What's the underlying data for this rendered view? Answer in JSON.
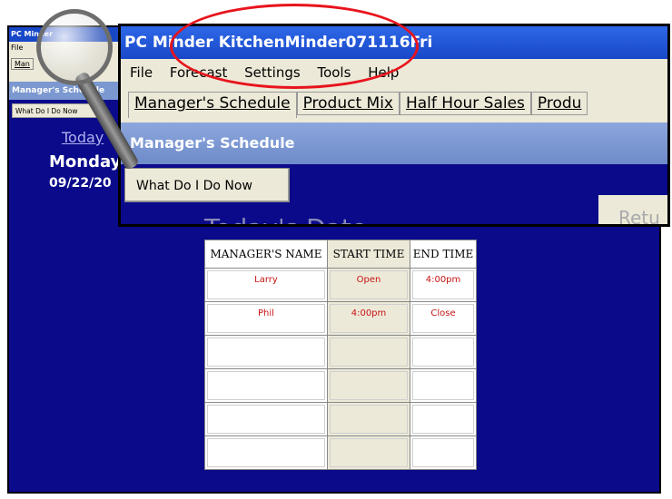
{
  "background_window": {
    "title": "PC Minder",
    "menu": [
      "File",
      "Man"
    ],
    "tabs": [
      "Manager's Schedule"
    ],
    "section_title": "Manager's Schedule",
    "what_do_button": "What Do I Do Now",
    "today_label": "Today",
    "day": "Monday",
    "date": "09/22/20"
  },
  "zoom_window": {
    "title": "PC Minder  KitchenMinder071116Fri",
    "menu": [
      "File",
      "Forecast",
      "Settings",
      "Tools",
      "Help"
    ],
    "tabs": [
      "Manager's Schedule",
      "Product Mix",
      "Half Hour Sales",
      "Produ"
    ],
    "section_title": "Manager's Schedule",
    "what_do_button": "What Do I Do Now",
    "today_label": "Today's Date",
    "return_button": "Retu"
  },
  "schedule": {
    "headers": [
      "MANAGER'S NAME",
      "START TIME",
      "END TIME"
    ],
    "rows": [
      [
        "Larry",
        "Open",
        "4:00pm"
      ],
      [
        "Phil",
        "4:00pm",
        "Close"
      ],
      [
        "",
        "",
        ""
      ],
      [
        "",
        "",
        ""
      ],
      [
        "",
        "",
        ""
      ],
      [
        "",
        "",
        ""
      ]
    ]
  },
  "colors": {
    "app_background": "#0a0a8a",
    "title_bar": "#1848c8",
    "highlight": "#e8141c",
    "table_text": "#c81414"
  }
}
